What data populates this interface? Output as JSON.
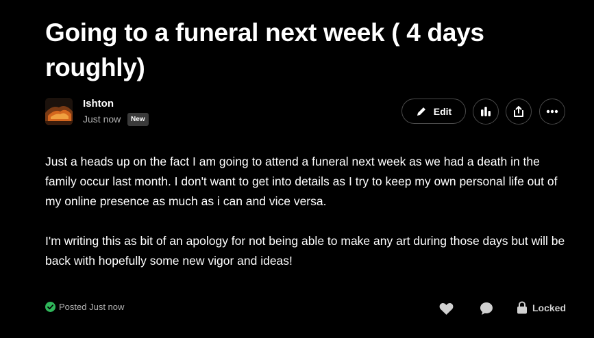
{
  "post": {
    "title": "Going to a funeral next week ( 4 days roughly)",
    "author": {
      "name": "Ishton",
      "time": "Just now",
      "badge": "New",
      "avatar_icon": "avatar-image"
    },
    "actions": {
      "edit_label": "Edit",
      "stats_icon": "bar-chart-icon",
      "share_icon": "share-icon",
      "more_icon": "more-icon"
    },
    "body": [
      "Just a heads up on the fact I am going to attend a funeral next week as we had a death in the family occur last month. I don't want to get into details as I try to keep my own personal life out of my online presence as much as i can and vice versa.",
      "I'm writing this as bit of an apology for not being able to make any art during those days but will be back with hopefully some new vigor and ideas!"
    ],
    "footer": {
      "posted_label": "Posted Just now",
      "locked_label": "Locked",
      "like_icon": "heart-icon",
      "comment_icon": "comment-icon",
      "lock_icon": "lock-icon"
    }
  },
  "colors": {
    "background": "#000000",
    "text": "#ffffff",
    "muted": "#b3b3b3",
    "success": "#2fb65a",
    "border": "#4a4a4a"
  }
}
